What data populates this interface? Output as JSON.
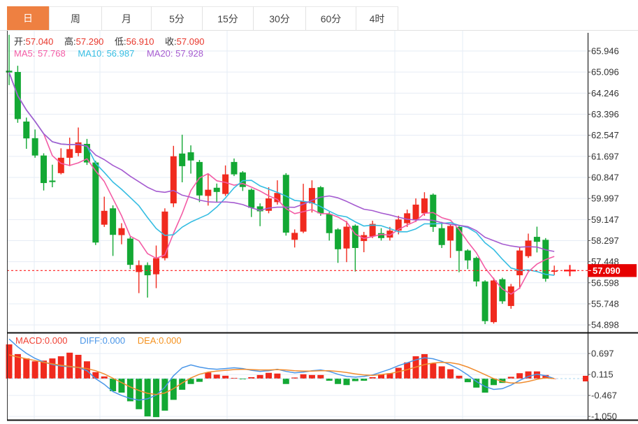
{
  "tabs": {
    "active": "日",
    "items": [
      {
        "label": "日"
      },
      {
        "label": "周"
      },
      {
        "label": "月"
      },
      {
        "label": "5分"
      },
      {
        "label": "15分"
      },
      {
        "label": "30分"
      },
      {
        "label": "60分"
      },
      {
        "label": "4时"
      }
    ]
  },
  "header": {
    "open_label": "开:",
    "open": "57.040",
    "high_label": "高:",
    "high": "57.290",
    "low_label": "低:",
    "low": "56.910",
    "close_label": "收:",
    "close": "57.090",
    "ma5_label": "MA5:",
    "ma5": "57.768",
    "ma10_label": "MA10:",
    "ma10": "56.987",
    "ma20_label": "MA20:",
    "ma20": "57.928"
  },
  "macd_header": {
    "macd_label": "MACD:",
    "macd": "0.000",
    "diff_label": "DIFF:",
    "diff": "0.000",
    "dea_label": "DEA:",
    "dea": "0.000"
  },
  "price_label": "57.090",
  "colors": {
    "up_red": "#f02a1e",
    "down_green": "#13a834",
    "ma5": "#f35ba5",
    "ma10": "#35bde2",
    "ma20": "#a55bd0",
    "diff_line": "#4a96e8",
    "dea_line": "#f08c2e",
    "tab_accent": "#ee8041",
    "price_line": "#ff1a1a",
    "price_label_bg": "#e60000",
    "grid": "#e6ecf5",
    "axis_text": "#333333"
  },
  "chart_data": {
    "type": "candlestick",
    "panels": [
      "price-kline",
      "macd"
    ],
    "price_axis_ticks": [
      65.946,
      65.096,
      64.246,
      63.396,
      62.547,
      61.697,
      60.847,
      59.997,
      59.147,
      58.297,
      57.448,
      56.598,
      55.748,
      54.898
    ],
    "macd_axis_ticks": [
      0.697,
      0.115,
      -0.467,
      -1.05
    ],
    "current_price": 57.09,
    "ma_periods": [
      5,
      10,
      20
    ],
    "ma_last_values": {
      "ma5": 57.768,
      "ma10": 56.987,
      "ma20": 57.928
    },
    "last_candle": {
      "open": 57.04,
      "high": 57.29,
      "low": 56.91,
      "close": 57.09
    },
    "candles_ohlc": [
      [
        65.15,
        66.6,
        64.57,
        65.08
      ],
      [
        65.1,
        65.35,
        63.05,
        63.2
      ],
      [
        63.1,
        63.26,
        62.0,
        62.42
      ],
      [
        62.43,
        62.78,
        61.64,
        61.73
      ],
      [
        61.73,
        61.82,
        60.32,
        60.62
      ],
      [
        60.72,
        61.36,
        60.45,
        60.66
      ],
      [
        61.02,
        62.02,
        60.97,
        61.64
      ],
      [
        61.64,
        62.45,
        61.3,
        61.99
      ],
      [
        61.83,
        62.86,
        61.7,
        62.26
      ],
      [
        62.2,
        62.4,
        61.35,
        61.45
      ],
      [
        61.45,
        61.52,
        58.12,
        58.22
      ],
      [
        58.94,
        60.07,
        58.85,
        59.5
      ],
      [
        59.6,
        59.72,
        57.68,
        58.53
      ],
      [
        58.52,
        59.0,
        58.15,
        58.8
      ],
      [
        58.38,
        58.45,
        57.15,
        57.32
      ],
      [
        57.03,
        57.5,
        56.18,
        57.31
      ],
      [
        57.31,
        57.42,
        56.0,
        56.9
      ],
      [
        56.94,
        58.1,
        56.38,
        57.59
      ],
      [
        57.59,
        59.6,
        57.5,
        59.47
      ],
      [
        59.8,
        62.12,
        59.65,
        61.7
      ],
      [
        61.81,
        62.57,
        60.65,
        61.3
      ],
      [
        61.86,
        62.14,
        61.0,
        61.53
      ],
      [
        61.47,
        61.55,
        59.85,
        60.12
      ],
      [
        60.1,
        60.97,
        59.71,
        60.35
      ],
      [
        60.43,
        60.6,
        59.84,
        60.26
      ],
      [
        60.18,
        61.33,
        60.1,
        60.97
      ],
      [
        61.47,
        61.61,
        60.9,
        60.97
      ],
      [
        61.05,
        61.1,
        60.3,
        60.46
      ],
      [
        60.35,
        60.4,
        59.25,
        59.62
      ],
      [
        59.68,
        59.8,
        58.88,
        59.48
      ],
      [
        59.5,
        60.45,
        59.4,
        60.0
      ],
      [
        59.85,
        60.73,
        59.75,
        60.22
      ],
      [
        60.95,
        61.02,
        58.5,
        58.62
      ],
      [
        58.33,
        58.75,
        58.02,
        58.61
      ],
      [
        58.66,
        60.59,
        58.6,
        59.88
      ],
      [
        59.8,
        60.73,
        59.43,
        60.42
      ],
      [
        60.45,
        60.5,
        59.3,
        59.4
      ],
      [
        59.37,
        59.45,
        58.3,
        58.6
      ],
      [
        58.75,
        58.8,
        57.4,
        57.95
      ],
      [
        57.98,
        59.09,
        57.43,
        58.86
      ],
      [
        58.9,
        58.95,
        57.05,
        58.0
      ],
      [
        58.28,
        58.65,
        57.83,
        58.52
      ],
      [
        58.47,
        59.1,
        58.4,
        58.97
      ],
      [
        58.6,
        58.8,
        58.3,
        58.4
      ],
      [
        58.42,
        58.85,
        58.3,
        58.7
      ],
      [
        58.7,
        59.3,
        58.55,
        59.15
      ],
      [
        59.0,
        59.55,
        58.85,
        59.4
      ],
      [
        59.15,
        60.0,
        59.05,
        59.75
      ],
      [
        59.4,
        60.25,
        59.3,
        60.0
      ],
      [
        60.15,
        60.2,
        58.65,
        58.85
      ],
      [
        58.8,
        59.05,
        58.0,
        58.12
      ],
      [
        58.3,
        58.95,
        57.6,
        58.89
      ],
      [
        58.85,
        58.9,
        57.02,
        57.88
      ],
      [
        57.9,
        57.95,
        57.15,
        57.5
      ],
      [
        57.6,
        57.65,
        56.45,
        56.65
      ],
      [
        56.65,
        56.7,
        54.93,
        55.05
      ],
      [
        55.01,
        56.8,
        54.95,
        56.69
      ],
      [
        56.74,
        56.8,
        55.75,
        55.85
      ],
      [
        55.66,
        56.55,
        55.55,
        56.45
      ],
      [
        56.9,
        58.05,
        56.35,
        57.9
      ],
      [
        57.67,
        58.58,
        57.6,
        58.3
      ],
      [
        58.45,
        58.86,
        57.82,
        58.25
      ],
      [
        58.33,
        58.4,
        56.64,
        56.76
      ],
      [
        57.04,
        57.29,
        56.91,
        57.09
      ]
    ],
    "macd": {
      "hist": [
        0.95,
        0.68,
        0.56,
        0.48,
        0.5,
        0.56,
        0.62,
        0.72,
        0.66,
        0.48,
        0.18,
        0.06,
        -0.35,
        -0.39,
        -0.63,
        -0.85,
        -1.05,
        -1.07,
        -0.89,
        -0.59,
        -0.31,
        -0.15,
        -0.09,
        0.17,
        0.11,
        0.08,
        0.02,
        -0.02,
        0.04,
        0.1,
        0.16,
        0.14,
        -0.15,
        0.03,
        0.12,
        0.1,
        0.1,
        -0.06,
        -0.15,
        -0.18,
        -0.07,
        -0.06,
        0.04,
        0.12,
        0.15,
        0.3,
        0.45,
        0.62,
        0.68,
        0.42,
        0.34,
        0.26,
        0.08,
        -0.1,
        -0.25,
        -0.39,
        -0.18,
        -0.12,
        0.05,
        0.15,
        0.2,
        0.2,
        0.1,
        0.0
      ],
      "diff": [
        1.1,
        0.88,
        0.7,
        0.56,
        0.46,
        0.39,
        0.35,
        0.33,
        0.31,
        0.22,
        0.0,
        -0.16,
        -0.36,
        -0.47,
        -0.55,
        -0.6,
        -0.56,
        -0.46,
        -0.24,
        0.08,
        0.3,
        0.38,
        0.32,
        0.28,
        0.26,
        0.28,
        0.3,
        0.28,
        0.23,
        0.2,
        0.22,
        0.26,
        0.2,
        0.16,
        0.18,
        0.22,
        0.24,
        0.2,
        0.12,
        0.06,
        0.04,
        0.06,
        0.1,
        0.18,
        0.26,
        0.36,
        0.44,
        0.52,
        0.58,
        0.55,
        0.48,
        0.38,
        0.26,
        0.1,
        -0.08,
        -0.22,
        -0.3,
        -0.28,
        -0.18,
        -0.05,
        0.06,
        0.12,
        0.08,
        0.0
      ],
      "dea": [
        0.66,
        0.6,
        0.55,
        0.5,
        0.45,
        0.41,
        0.37,
        0.34,
        0.31,
        0.28,
        0.22,
        0.13,
        0.01,
        -0.11,
        -0.23,
        -0.33,
        -0.41,
        -0.44,
        -0.4,
        -0.28,
        -0.12,
        0.02,
        0.12,
        0.18,
        0.21,
        0.23,
        0.25,
        0.26,
        0.25,
        0.24,
        0.24,
        0.25,
        0.24,
        0.22,
        0.21,
        0.21,
        0.22,
        0.22,
        0.2,
        0.17,
        0.13,
        0.1,
        0.09,
        0.11,
        0.14,
        0.19,
        0.25,
        0.32,
        0.39,
        0.43,
        0.45,
        0.44,
        0.4,
        0.32,
        0.22,
        0.11,
        0.0,
        -0.08,
        -0.12,
        -0.12,
        -0.08,
        -0.02,
        0.02,
        0.0
      ]
    }
  }
}
